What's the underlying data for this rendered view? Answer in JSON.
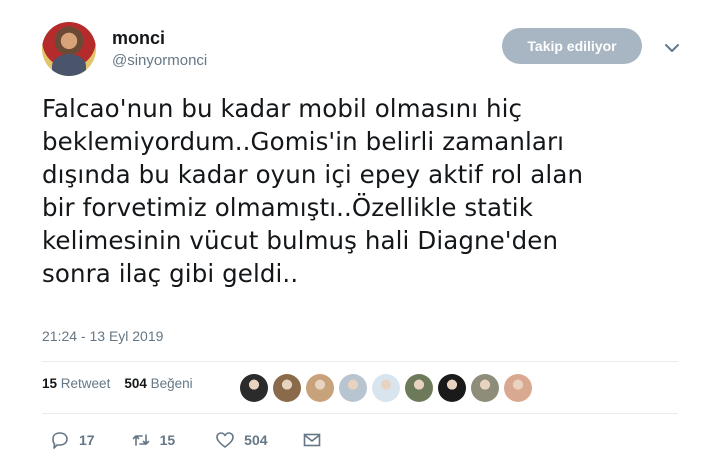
{
  "user": {
    "name": "monci",
    "handle": "@sinyormonci",
    "follow_label": "Takip ediliyor"
  },
  "tweet": {
    "text": "Falcao'nun bu kadar mobil olmasını hiç\nbeklemiyordum..Gomis'in belirli zamanları\ndışında bu kadar oyun içi epey aktif rol alan\nbir forvetimiz olmamıştı..Özellikle statik\nkelimesinin vücut bulmuş hali Diagne'den\nsonra ilaç gibi geldi..",
    "timestamp": "21:24 - 13 Eyl 2019"
  },
  "stats": {
    "retweet_count": "15",
    "retweet_label": "Retweet",
    "like_count": "504",
    "like_label": "Beğeni"
  },
  "likers": [
    {
      "icon": "liker-avatar",
      "color": "#2b2b2b"
    },
    {
      "icon": "liker-avatar",
      "color": "#8a6a4a"
    },
    {
      "icon": "liker-avatar",
      "color": "#c7a27a"
    },
    {
      "icon": "liker-avatar",
      "color": "#b8c4d0"
    },
    {
      "icon": "liker-avatar",
      "color": "#d8e4ee"
    },
    {
      "icon": "liker-avatar",
      "color": "#6d7a5a"
    },
    {
      "icon": "liker-avatar",
      "color": "#1a1a1a"
    },
    {
      "icon": "liker-avatar",
      "color": "#8d8d7a"
    },
    {
      "icon": "liker-avatar",
      "color": "#d9a890"
    }
  ],
  "actions": {
    "reply_count": "17",
    "retweet_count": "15",
    "like_count": "504"
  },
  "colors": {
    "text": "#14171a",
    "muted": "#657786",
    "follow_button": "#a8b5c2",
    "divider": "#e6ecf0"
  }
}
